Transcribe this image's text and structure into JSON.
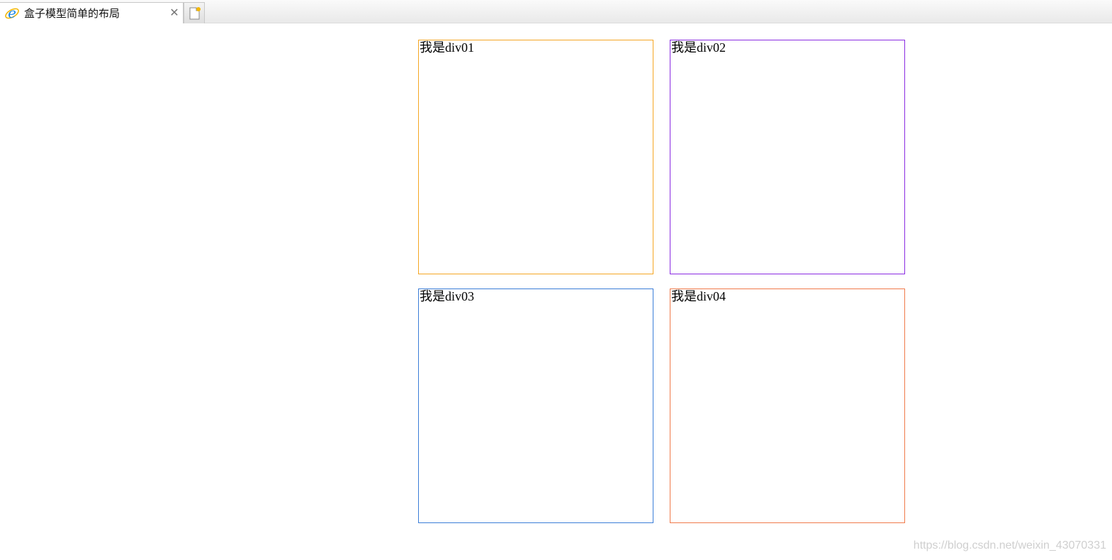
{
  "browser": {
    "tab": {
      "title": "盒子模型简单的布局",
      "close_icon": "close-icon",
      "favicon": "ie-icon"
    },
    "new_tab_icon": "new-tab-icon"
  },
  "page": {
    "boxes": [
      {
        "label": "我是div01",
        "border_color": "#f5a623"
      },
      {
        "label": "我是div02",
        "border_color": "#8a2be2"
      },
      {
        "label": "我是div03",
        "border_color": "#3b7dd8"
      },
      {
        "label": "我是div04",
        "border_color": "#f07a4a"
      }
    ]
  },
  "watermark": "https://blog.csdn.net/weixin_43070331",
  "colors": {
    "tabbar_bg": "#eeeeee",
    "ie_blue": "#1e88e5",
    "ie_gold": "#f2b705"
  }
}
